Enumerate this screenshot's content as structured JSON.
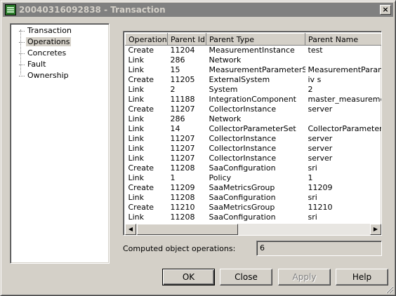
{
  "window": {
    "title": "20040316092838 - Transaction",
    "close_glyph": "×"
  },
  "tree": {
    "items": [
      {
        "label": "Transaction",
        "selected": false
      },
      {
        "label": "Operations",
        "selected": true
      },
      {
        "label": "Concretes",
        "selected": false
      },
      {
        "label": "Fault",
        "selected": false
      },
      {
        "label": "Ownership",
        "selected": false
      }
    ]
  },
  "grid": {
    "columns": [
      "Operation",
      "Parent Id",
      "Parent Type",
      "Parent Name"
    ],
    "rows": [
      [
        "Create",
        "11204",
        "MeasurementInstance",
        "test"
      ],
      [
        "Link",
        "286",
        "Network",
        ""
      ],
      [
        "Link",
        "15",
        "MeasurementParameterSet",
        "MeasurementParamete"
      ],
      [
        "Create",
        "11205",
        "ExternalSystem",
        "iv s"
      ],
      [
        "Link",
        "2",
        "System",
        "2"
      ],
      [
        "Link",
        "11188",
        "IntegrationComponent",
        "master_measurement_"
      ],
      [
        "Create",
        "11207",
        "CollectorInstance",
        "server"
      ],
      [
        "Link",
        "286",
        "Network",
        ""
      ],
      [
        "Link",
        "14",
        "CollectorParameterSet",
        "CollectorParameterSet"
      ],
      [
        "Link",
        "11207",
        "CollectorInstance",
        "server"
      ],
      [
        "Link",
        "11207",
        "CollectorInstance",
        "server"
      ],
      [
        "Link",
        "11207",
        "CollectorInstance",
        "server"
      ],
      [
        "Create",
        "11208",
        "SaaConfiguration",
        "sri"
      ],
      [
        "Link",
        "1",
        "Policy",
        "1"
      ],
      [
        "Create",
        "11209",
        "SaaMetricsGroup",
        "11209"
      ],
      [
        "Link",
        "11208",
        "SaaConfiguration",
        "sri"
      ],
      [
        "Create",
        "11210",
        "SaaMetricsGroup",
        "11210"
      ],
      [
        "Link",
        "11208",
        "SaaConfiguration",
        "sri"
      ]
    ],
    "scroll_left_glyph": "◀",
    "scroll_right_glyph": "▶"
  },
  "computed": {
    "label": "Computed object operations:",
    "value": "6"
  },
  "buttons": {
    "ok": "OK",
    "close": "Close",
    "apply": "Apply",
    "help": "Help"
  },
  "icons": {
    "app": "list-window-icon",
    "grip": "resize-grip-icon"
  }
}
